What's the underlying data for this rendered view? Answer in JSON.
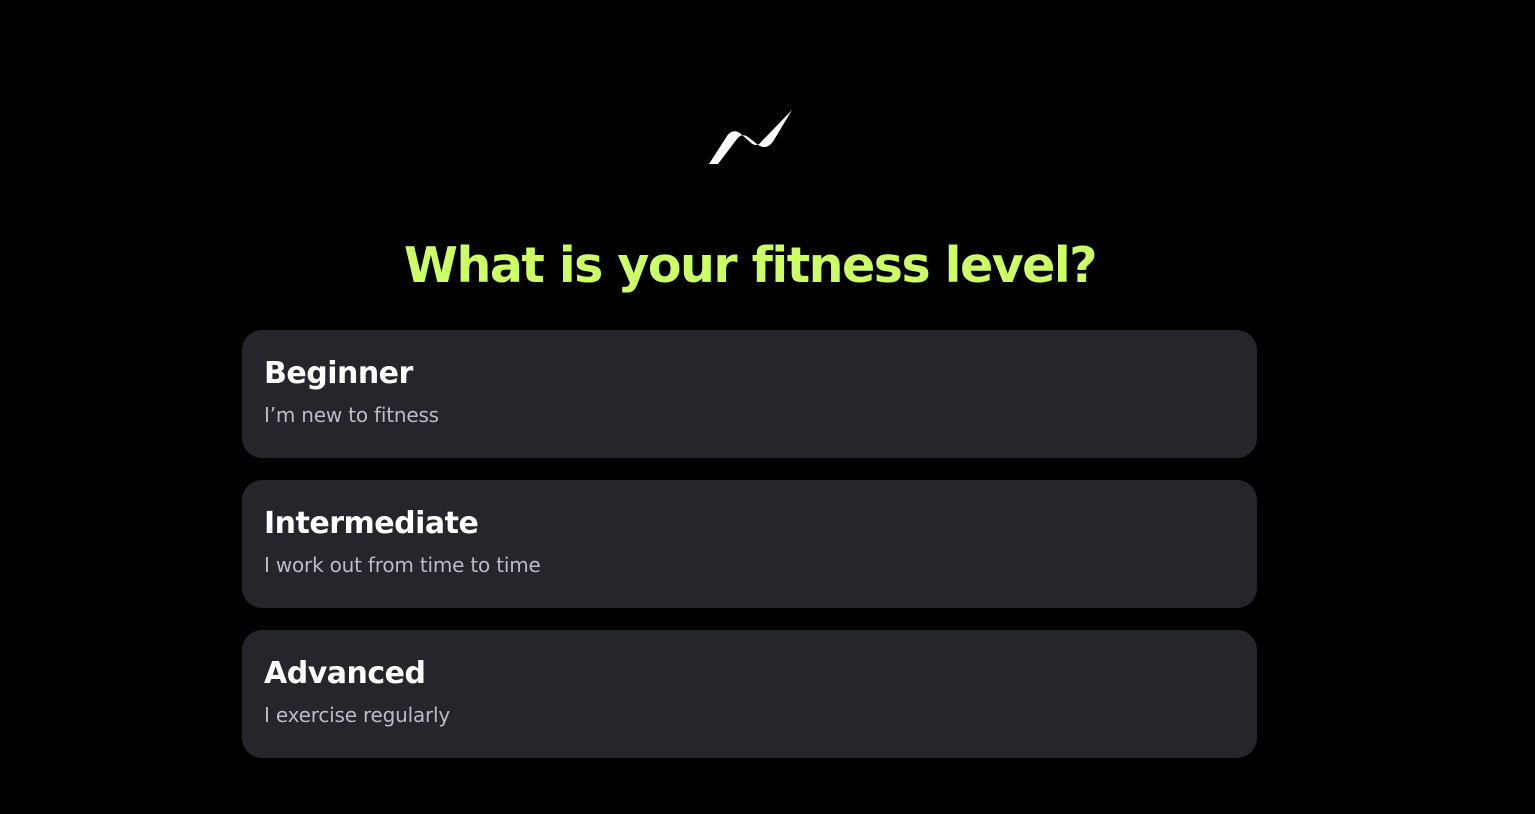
{
  "colors": {
    "background": "#000000",
    "accent": "#ccff66",
    "card": "#25262b",
    "description": "#b9bcc8"
  },
  "logo": {
    "icon": "bolt-wave-icon"
  },
  "question": {
    "title": "What is your fitness level?"
  },
  "options": [
    {
      "label": "Beginner",
      "description": "I’m new to fitness"
    },
    {
      "label": "Intermediate",
      "description": "I work out from time to time"
    },
    {
      "label": "Advanced",
      "description": "I exercise regularly"
    }
  ]
}
